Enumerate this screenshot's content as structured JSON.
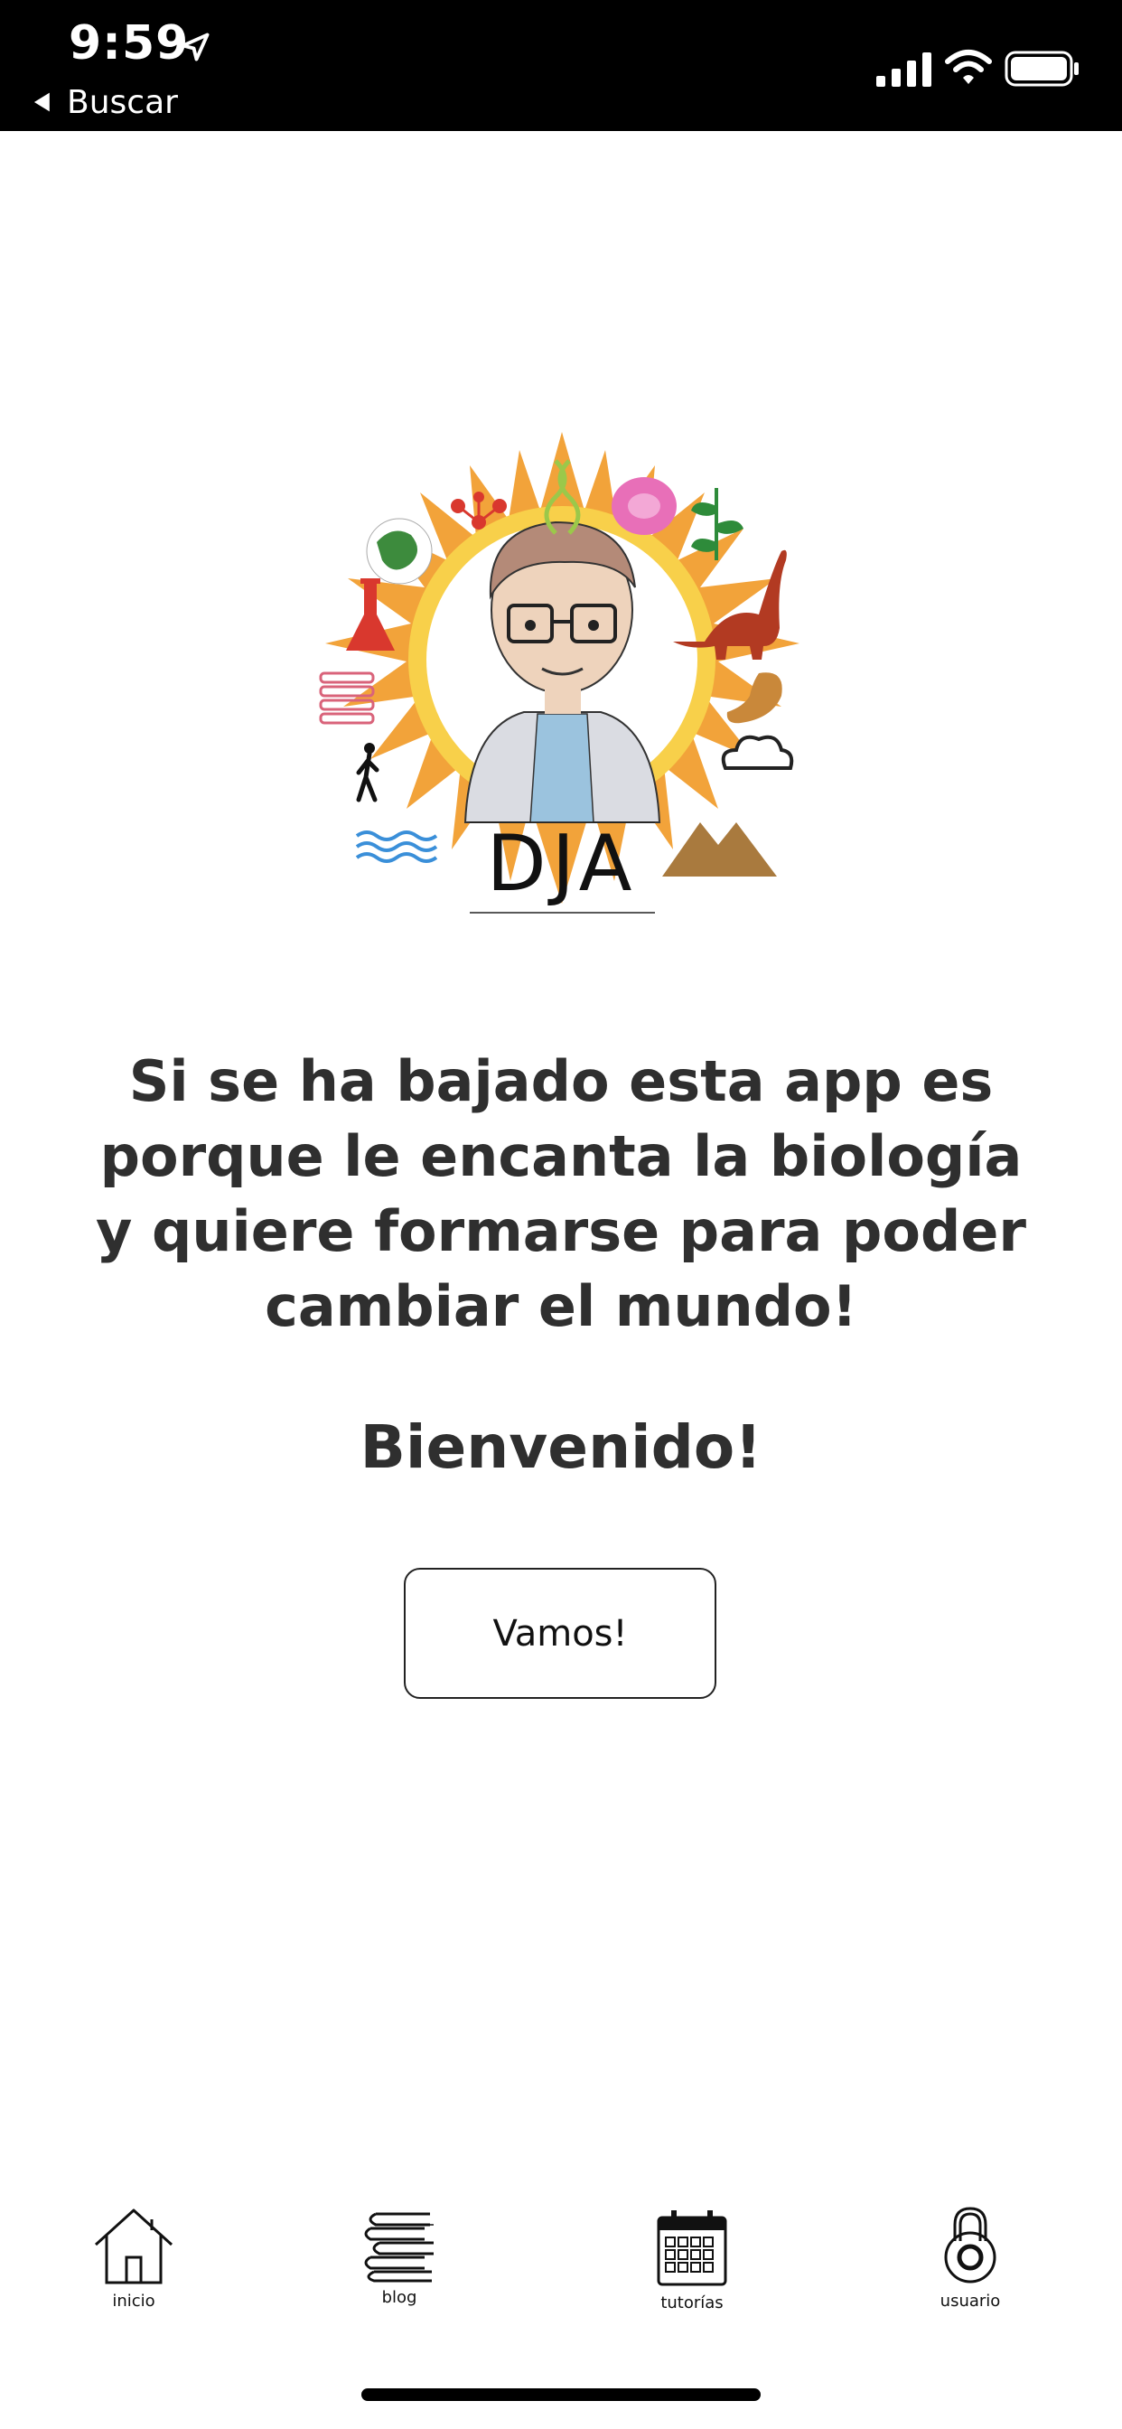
{
  "status_bar": {
    "time": "9:59",
    "back_label": "Buscar",
    "icons": [
      "location-arrow-icon",
      "cellular-signal-icon",
      "wifi-icon",
      "battery-icon"
    ]
  },
  "logo": {
    "text": "DJA",
    "icons": [
      "globe-icon",
      "molecule-icon",
      "dna-icon",
      "cell-icon",
      "plant-icon",
      "dinosaur-icon",
      "flask-icon",
      "books-icon",
      "stomach-icon",
      "cloud-icon",
      "walking-person-icon",
      "waves-icon",
      "mountain-icon"
    ],
    "colors": {
      "sun_outer": "#F2A33A",
      "sun_inner": "#F8D04A",
      "flask": "#D9382E",
      "dinosaur": "#B23A22",
      "plant": "#2E8B3A",
      "mountain": "#A97A3E",
      "waves": "#3A8FD9",
      "books": "#D9637A",
      "cell": "#E86FB8"
    }
  },
  "main": {
    "message": "Si se ha bajado esta app es porque le encanta la biología y quiere formarse para poder cambiar el mundo!",
    "welcome": "Bienvenido!",
    "button_label": "Vamos!"
  },
  "tab_bar": {
    "tabs": [
      {
        "label": "inicio",
        "icon": "house-icon"
      },
      {
        "label": "blog",
        "icon": "books-stack-icon"
      },
      {
        "label": "tutorías",
        "icon": "calendar-icon"
      },
      {
        "label": "usuario",
        "icon": "padlock-icon"
      }
    ]
  }
}
